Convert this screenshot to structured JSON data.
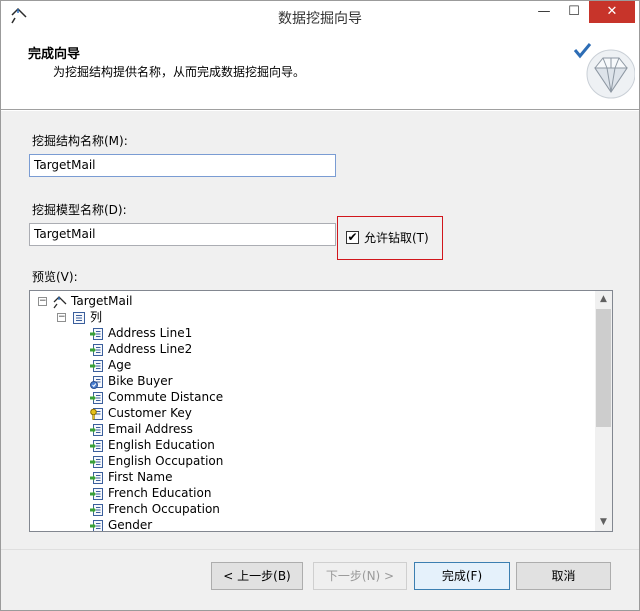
{
  "window": {
    "title": "数据挖掘向导",
    "minimize_glyph": "—",
    "maximize_glyph": "☐",
    "close_glyph": "✕"
  },
  "header": {
    "title": "完成向导",
    "description": "为挖掘结构提供名称，从而完成数据挖掘向导。"
  },
  "form": {
    "structure_name_label": "挖掘结构名称(M):",
    "structure_name_value": "TargetMail",
    "model_name_label": "挖掘模型名称(D):",
    "model_name_value": "TargetMail",
    "allow_drillthrough_label": "允许钻取(T)",
    "allow_drillthrough_checked": true,
    "preview_label": "预览(V):"
  },
  "tree": {
    "root_label": "TargetMail",
    "columns_label": "列",
    "collapse_glyph": "−",
    "columns": [
      {
        "label": "Address Line1",
        "icon": "input-column-icon"
      },
      {
        "label": "Address Line2",
        "icon": "input-column-icon"
      },
      {
        "label": "Age",
        "icon": "input-column-icon"
      },
      {
        "label": "Bike Buyer",
        "icon": "predict-column-icon"
      },
      {
        "label": "Commute Distance",
        "icon": "input-column-icon"
      },
      {
        "label": "Customer Key",
        "icon": "key-column-icon"
      },
      {
        "label": "Email Address",
        "icon": "input-column-icon"
      },
      {
        "label": "English Education",
        "icon": "input-column-icon"
      },
      {
        "label": "English Occupation",
        "icon": "input-column-icon"
      },
      {
        "label": "First Name",
        "icon": "input-column-icon"
      },
      {
        "label": "French Education",
        "icon": "input-column-icon"
      },
      {
        "label": "French Occupation",
        "icon": "input-column-icon"
      },
      {
        "label": "Gender",
        "icon": "input-column-icon"
      }
    ]
  },
  "buttons": {
    "back": "< 上一步(B)",
    "next": "下一步(N) >",
    "finish": "完成(F)",
    "cancel": "取消"
  }
}
